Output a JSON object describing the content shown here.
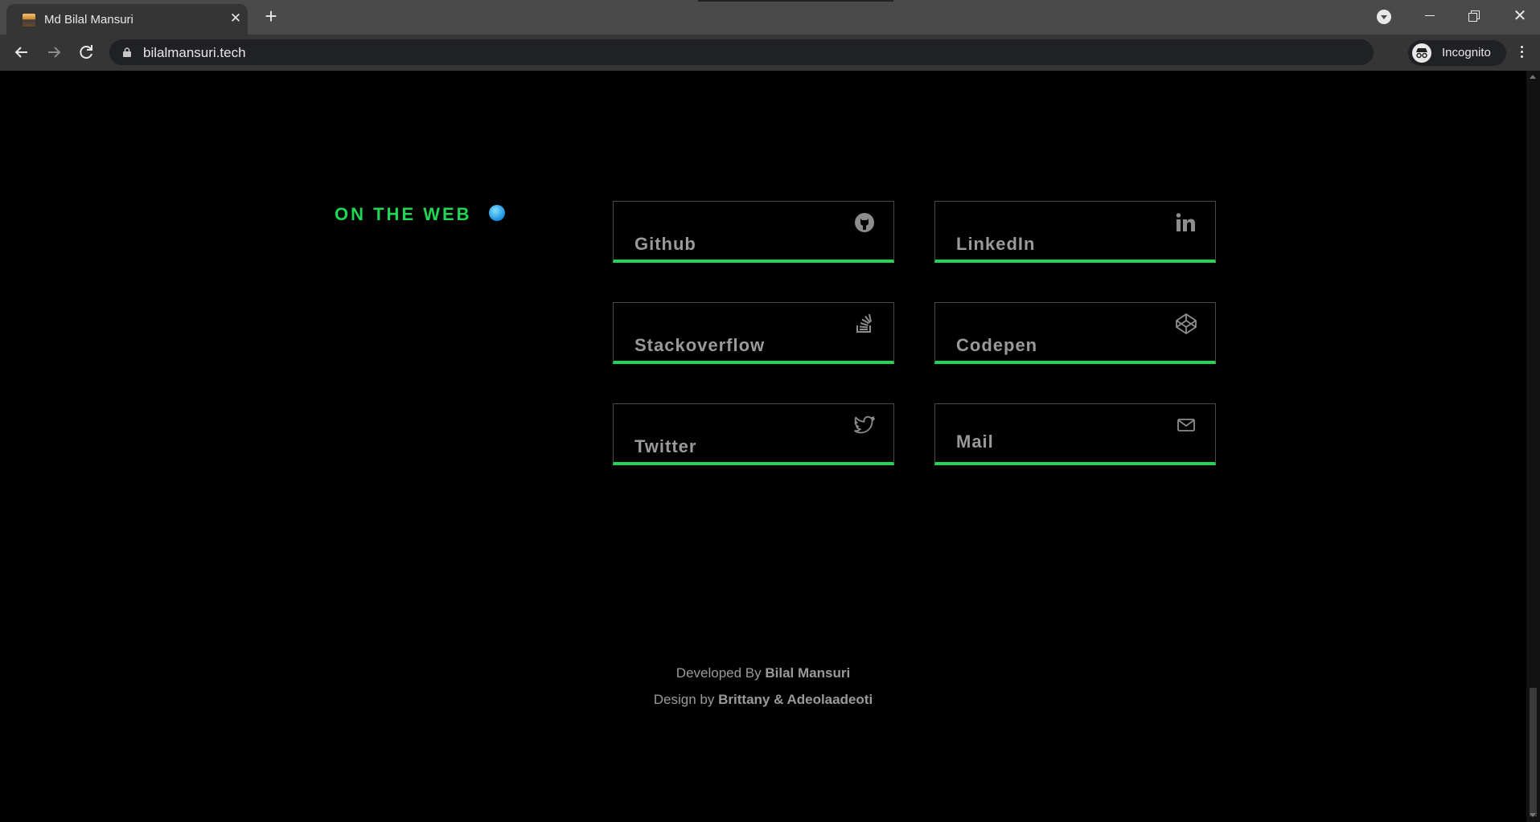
{
  "browser": {
    "tab_title": "Md Bilal Mansuri",
    "url": "bilalmansuri.tech",
    "profile_label": "Incognito"
  },
  "page": {
    "section_title": "ON THE WEB",
    "links": [
      {
        "label": "Github",
        "icon": "github-icon"
      },
      {
        "label": "LinkedIn",
        "icon": "linkedin-icon"
      },
      {
        "label": "Stackoverflow",
        "icon": "stackoverflow-icon"
      },
      {
        "label": "Codepen",
        "icon": "codepen-icon"
      },
      {
        "label": "Twitter",
        "icon": "twitter-icon"
      },
      {
        "label": "Mail",
        "icon": "mail-icon"
      }
    ],
    "footer": {
      "developed_prefix": "Developed By",
      "developer_name": "Bilal Mansuri",
      "design_prefix": "Design by",
      "designers": "Brittany & Adeolaadeoti"
    }
  },
  "colors": {
    "accent": "#1fd655",
    "background": "#000000",
    "muted_text": "#9a9a9a"
  }
}
